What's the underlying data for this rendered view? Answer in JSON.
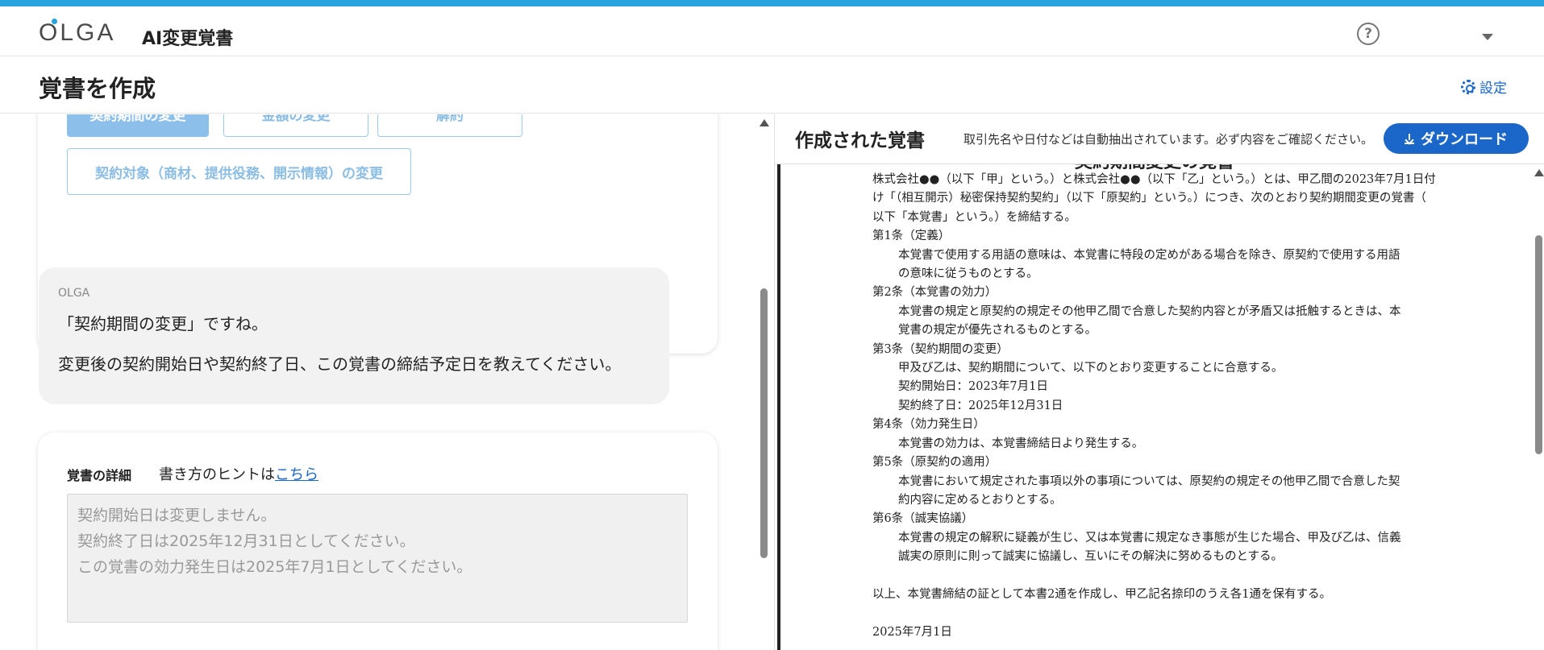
{
  "header": {
    "logo_text": "OLGA",
    "app_title": "AI変更覚書",
    "help_glyph": "?"
  },
  "subheader": {
    "page_title": "覚書を作成",
    "settings_label": "設定"
  },
  "options": [
    {
      "label": "契約期間の変更",
      "active": true
    },
    {
      "label": "金額の変更",
      "active": false
    },
    {
      "label": "解約",
      "active": false
    },
    {
      "label": "契約対象（商材、提供役務、開示情報）の変更",
      "active": false
    }
  ],
  "assistant": {
    "sender": "OLGA",
    "line1": "「契約期間の変更」ですね。",
    "line2": "変更後の契約開始日や契約終了日、この覚書の締結予定日を教えてください。"
  },
  "details": {
    "label": "覚書の詳細",
    "hint_prefix": "書き方のヒントは",
    "hint_link": "こちら",
    "placeholder_lines": [
      "契約開始日は変更しません。",
      "契約終了日は2025年12月31日としてください。",
      "この覚書の効力発生日は2025年7月1日としてください。"
    ]
  },
  "result": {
    "title": "作成された覚書",
    "note": "取引先名や日付などは自動抽出されています。必ず内容をご確認ください。",
    "download_label": "ダウンロード"
  },
  "document": {
    "title": "契約期間変更の覚書",
    "intro": [
      "株式会社●●（以下「甲」という。）と株式会社●●（以下「乙」という。）とは、甲乙間の2023年7月1日付",
      "け「（相互開示）秘密保持契約契約」（以下「原契約」という。）につき、次のとおり契約期間変更の覚書（",
      "以下「本覚書」という。）を締結する。"
    ],
    "articles": [
      {
        "heading": "第1条（定義）",
        "lines": [
          "本覚書で使用する用語の意味は、本覚書に特段の定めがある場合を除き、原契約で使用する用語",
          "の意味に従うものとする。"
        ]
      },
      {
        "heading": "第2条（本覚書の効力）",
        "lines": [
          "本覚書の規定と原契約の規定その他甲乙間で合意した契約内容とが矛盾又は抵触するときは、本",
          "覚書の規定が優先されるものとする。"
        ]
      },
      {
        "heading": "第3条（契約期間の変更）",
        "lines": [
          "甲及び乙は、契約期間について、以下のとおり変更することに合意する。",
          "契約開始日：2023年7月1日",
          "契約終了日：2025年12月31日"
        ]
      },
      {
        "heading": "第4条（効力発生日）",
        "lines": [
          "本覚書の効力は、本覚書締結日より発生する。"
        ]
      },
      {
        "heading": "第5条（原契約の適用）",
        "lines": [
          "本覚書において規定された事項以外の事項については、原契約の規定その他甲乙間で合意した契",
          "約内容に定めるとおりとする。"
        ]
      },
      {
        "heading": "第6条（誠実協議）",
        "lines": [
          "本覚書の規定の解釈に疑義が生じ、又は本覚書に規定なき事態が生じた場合、甲及び乙は、信義",
          "誠実の原則に則って誠実に協議し、互いにその解決に努めるものとする。"
        ]
      }
    ],
    "closing": "以上、本覚書締結の証として本書2通を作成し、甲乙記名捺印のうえ各1通を保有する。",
    "date": "2025年7月1日"
  },
  "colors": {
    "accent": "#1a66c9",
    "stripe": "#29a3e0",
    "option_active": "#8cbfea"
  }
}
